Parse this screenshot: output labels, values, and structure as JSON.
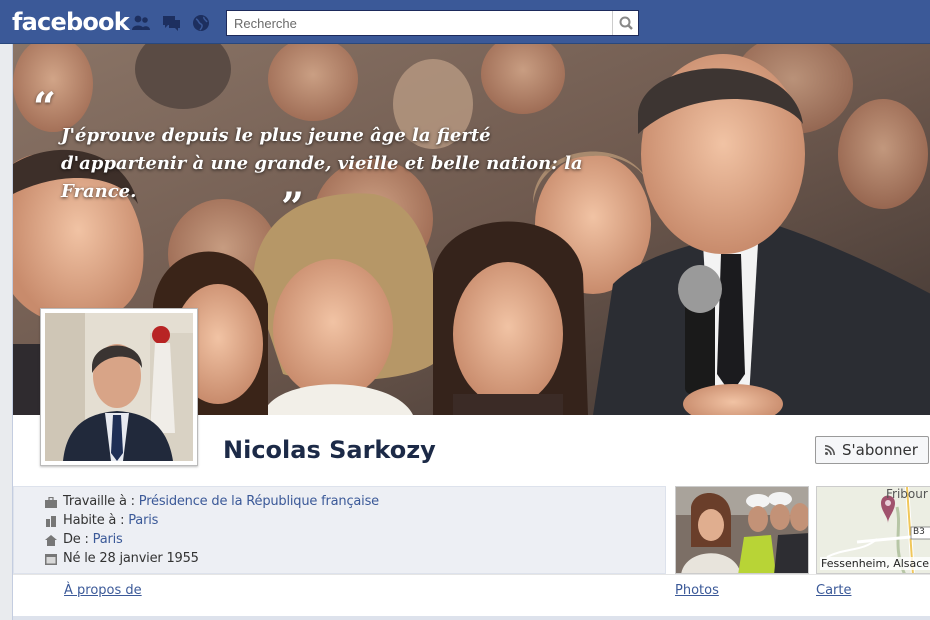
{
  "topbar": {
    "logo": "facebook",
    "search_placeholder": "Recherche"
  },
  "cover": {
    "quote": "J'éprouve depuis le plus jeune âge la fierté d'appartenir à une grande, vieille et belle nation: la France.",
    "open_quote": "“",
    "close_quote": "”"
  },
  "profile": {
    "name": "Nicolas Sarkozy",
    "subscribe_label": "S'abonner"
  },
  "info": {
    "work_prefix": "Travaille à : ",
    "work_link": "Présidence de la République française",
    "lives_prefix": "Habite à : ",
    "lives_link": "Paris",
    "from_prefix": "De : ",
    "from_link": "Paris",
    "born": "Né le 28 janvier 1955"
  },
  "map": {
    "city_top": "Fribour",
    "location": "Fessenheim, Alsace,",
    "road": "B3"
  },
  "tabs": {
    "about": "À propos de",
    "photos": "Photos",
    "map": "Carte"
  },
  "colors": {
    "brand": "#3b5998",
    "name": "#1c2a47"
  }
}
